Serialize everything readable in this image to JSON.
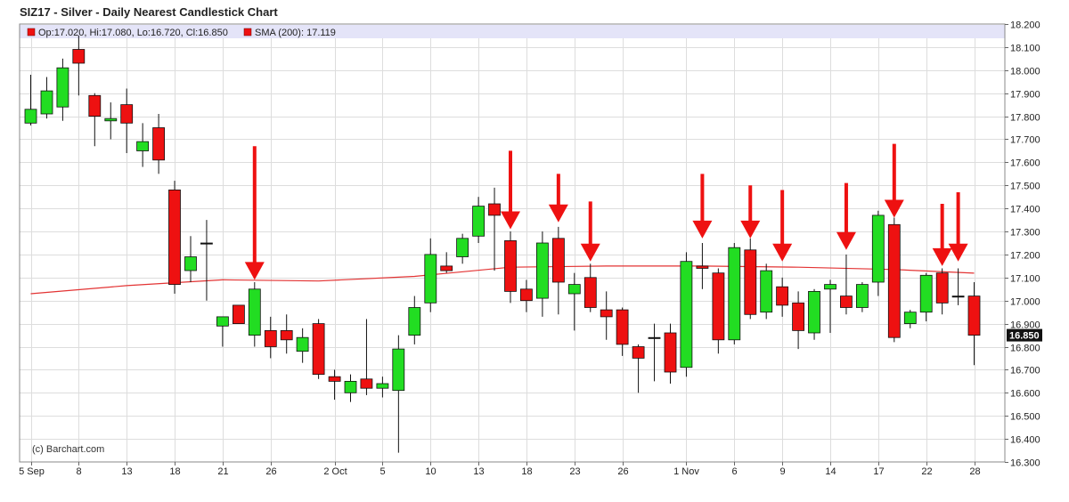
{
  "title": "SIZ17 - Silver - Daily Nearest Candlestick Chart",
  "legend": {
    "ohlc_text": "Op:17.020, Hi:17.080, Lo:16.720, Cl:16.850",
    "sma_text": "SMA (200): 17.119"
  },
  "copyright": "(c) Barchart.com",
  "last_price_label": "16.850",
  "colors": {
    "up": "#22dd22",
    "down": "#ee1111",
    "sma": "#e33333",
    "arrow": "#ee1111",
    "legend_bg": "#e4e4f8",
    "grid": "#dddddd",
    "last_price_bg": "#111111"
  },
  "chart_data": {
    "type": "candlestick",
    "title": "SIZ17 - Silver - Daily Nearest Candlestick Chart",
    "ylim": [
      16.3,
      18.2
    ],
    "y_ticks": [
      16.3,
      16.4,
      16.5,
      16.6,
      16.7,
      16.8,
      16.9,
      17.0,
      17.1,
      17.2,
      17.3,
      17.4,
      17.5,
      17.6,
      17.7,
      17.8,
      17.9,
      18.0,
      18.1,
      18.2
    ],
    "y_tick_labels": [
      "16.300",
      "16.400",
      "16.500",
      "16.600",
      "16.700",
      "16.800",
      "16.900",
      "17.000",
      "17.100",
      "17.200",
      "17.300",
      "17.400",
      "17.500",
      "17.600",
      "17.700",
      "17.800",
      "17.900",
      "18.000",
      "18.100",
      "18.200"
    ],
    "x_tick_labels": [
      {
        "label": "5 Sep",
        "index": 0
      },
      {
        "label": "8",
        "index": 3
      },
      {
        "label": "13",
        "index": 6
      },
      {
        "label": "18",
        "index": 9
      },
      {
        "label": "21",
        "index": 12
      },
      {
        "label": "26",
        "index": 15
      },
      {
        "label": "2 Oct",
        "index": 19
      },
      {
        "label": "5",
        "index": 22
      },
      {
        "label": "10",
        "index": 25
      },
      {
        "label": "13",
        "index": 28
      },
      {
        "label": "18",
        "index": 31
      },
      {
        "label": "23",
        "index": 34
      },
      {
        "label": "26",
        "index": 37
      },
      {
        "label": "1 Nov",
        "index": 41
      },
      {
        "label": "6",
        "index": 44
      },
      {
        "label": "9",
        "index": 47
      },
      {
        "label": "14",
        "index": 50
      },
      {
        "label": "17",
        "index": 53
      },
      {
        "label": "22",
        "index": 56
      },
      {
        "label": "28",
        "index": 59
      }
    ],
    "candles": [
      {
        "o": 17.77,
        "h": 17.98,
        "l": 17.76,
        "c": 17.83
      },
      {
        "o": 17.81,
        "h": 17.97,
        "l": 17.79,
        "c": 17.91
      },
      {
        "o": 17.84,
        "h": 18.05,
        "l": 17.78,
        "c": 18.01
      },
      {
        "o": 18.09,
        "h": 18.15,
        "l": 17.89,
        "c": 18.03
      },
      {
        "o": 17.89,
        "h": 17.9,
        "l": 17.67,
        "c": 17.8
      },
      {
        "o": 17.78,
        "h": 17.86,
        "l": 17.7,
        "c": 17.79
      },
      {
        "o": 17.85,
        "h": 17.92,
        "l": 17.64,
        "c": 17.77
      },
      {
        "o": 17.65,
        "h": 17.77,
        "l": 17.58,
        "c": 17.69
      },
      {
        "o": 17.75,
        "h": 17.81,
        "l": 17.55,
        "c": 17.61
      },
      {
        "o": 17.48,
        "h": 17.52,
        "l": 17.03,
        "c": 17.07
      },
      {
        "o": 17.13,
        "h": 17.28,
        "l": 17.08,
        "c": 17.19
      },
      {
        "o": 17.25,
        "h": 17.35,
        "l": 17.0,
        "c": 17.25
      },
      {
        "o": 16.89,
        "h": 16.93,
        "l": 16.8,
        "c": 16.93
      },
      {
        "o": 16.98,
        "h": 16.98,
        "l": 16.9,
        "c": 16.9
      },
      {
        "o": 16.85,
        "h": 17.08,
        "l": 16.8,
        "c": 17.05
      },
      {
        "o": 16.87,
        "h": 16.93,
        "l": 16.75,
        "c": 16.8
      },
      {
        "o": 16.87,
        "h": 16.94,
        "l": 16.77,
        "c": 16.83
      },
      {
        "o": 16.78,
        "h": 16.88,
        "l": 16.73,
        "c": 16.84
      },
      {
        "o": 16.9,
        "h": 16.92,
        "l": 16.66,
        "c": 16.68
      },
      {
        "o": 16.67,
        "h": 16.7,
        "l": 16.57,
        "c": 16.65
      },
      {
        "o": 16.6,
        "h": 16.68,
        "l": 16.56,
        "c": 16.65
      },
      {
        "o": 16.66,
        "h": 16.92,
        "l": 16.59,
        "c": 16.62
      },
      {
        "o": 16.62,
        "h": 16.67,
        "l": 16.58,
        "c": 16.64
      },
      {
        "o": 16.61,
        "h": 16.85,
        "l": 16.34,
        "c": 16.79
      },
      {
        "o": 16.85,
        "h": 17.02,
        "l": 16.81,
        "c": 16.97
      },
      {
        "o": 16.99,
        "h": 17.27,
        "l": 16.95,
        "c": 17.2
      },
      {
        "o": 17.15,
        "h": 17.21,
        "l": 17.12,
        "c": 17.13
      },
      {
        "o": 17.19,
        "h": 17.29,
        "l": 17.16,
        "c": 17.27
      },
      {
        "o": 17.28,
        "h": 17.45,
        "l": 17.25,
        "c": 17.41
      },
      {
        "o": 17.42,
        "h": 17.49,
        "l": 17.13,
        "c": 17.37
      },
      {
        "o": 17.26,
        "h": 17.3,
        "l": 16.99,
        "c": 17.04
      },
      {
        "o": 17.05,
        "h": 17.09,
        "l": 16.95,
        "c": 17.0
      },
      {
        "o": 17.01,
        "h": 17.3,
        "l": 16.93,
        "c": 17.25
      },
      {
        "o": 17.27,
        "h": 17.32,
        "l": 16.94,
        "c": 17.08
      },
      {
        "o": 17.03,
        "h": 17.12,
        "l": 16.87,
        "c": 17.07
      },
      {
        "o": 17.1,
        "h": 17.16,
        "l": 16.95,
        "c": 16.97
      },
      {
        "o": 16.96,
        "h": 17.04,
        "l": 16.83,
        "c": 16.93
      },
      {
        "o": 16.96,
        "h": 16.97,
        "l": 16.76,
        "c": 16.81
      },
      {
        "o": 16.8,
        "h": 16.81,
        "l": 16.6,
        "c": 16.75
      },
      {
        "o": 16.84,
        "h": 16.9,
        "l": 16.65,
        "c": 16.84
      },
      {
        "o": 16.86,
        "h": 16.9,
        "l": 16.64,
        "c": 16.69
      },
      {
        "o": 16.71,
        "h": 17.21,
        "l": 16.67,
        "c": 17.17
      },
      {
        "o": 17.15,
        "h": 17.25,
        "l": 17.05,
        "c": 17.14
      },
      {
        "o": 17.12,
        "h": 17.14,
        "l": 16.77,
        "c": 16.83
      },
      {
        "o": 16.83,
        "h": 17.25,
        "l": 16.81,
        "c": 17.23
      },
      {
        "o": 17.22,
        "h": 17.27,
        "l": 16.92,
        "c": 16.94
      },
      {
        "o": 16.95,
        "h": 17.16,
        "l": 16.92,
        "c": 17.13
      },
      {
        "o": 17.06,
        "h": 17.1,
        "l": 16.93,
        "c": 16.98
      },
      {
        "o": 16.99,
        "h": 17.04,
        "l": 16.79,
        "c": 16.87
      },
      {
        "o": 16.86,
        "h": 17.05,
        "l": 16.83,
        "c": 17.04
      },
      {
        "o": 17.05,
        "h": 17.09,
        "l": 16.86,
        "c": 17.07
      },
      {
        "o": 17.02,
        "h": 17.2,
        "l": 16.94,
        "c": 16.97
      },
      {
        "o": 16.97,
        "h": 17.08,
        "l": 16.95,
        "c": 17.07
      },
      {
        "o": 17.08,
        "h": 17.39,
        "l": 17.02,
        "c": 17.37
      },
      {
        "o": 17.33,
        "h": 17.36,
        "l": 16.82,
        "c": 16.84
      },
      {
        "o": 16.9,
        "h": 16.96,
        "l": 16.88,
        "c": 16.95
      },
      {
        "o": 16.95,
        "h": 17.12,
        "l": 16.91,
        "c": 17.11
      },
      {
        "o": 17.12,
        "h": 17.14,
        "l": 16.94,
        "c": 16.99
      },
      {
        "o": 17.02,
        "h": 17.14,
        "l": 16.98,
        "c": 17.02
      },
      {
        "o": 17.02,
        "h": 17.08,
        "l": 16.72,
        "c": 16.85
      }
    ],
    "sma": {
      "period": 200,
      "points": [
        {
          "index": 0,
          "value": 17.03
        },
        {
          "index": 6,
          "value": 17.065
        },
        {
          "index": 12,
          "value": 17.09
        },
        {
          "index": 18,
          "value": 17.085
        },
        {
          "index": 24,
          "value": 17.105
        },
        {
          "index": 30,
          "value": 17.145
        },
        {
          "index": 36,
          "value": 17.15
        },
        {
          "index": 42,
          "value": 17.15
        },
        {
          "index": 48,
          "value": 17.145
        },
        {
          "index": 54,
          "value": 17.135
        },
        {
          "index": 59,
          "value": 17.119
        }
      ]
    },
    "arrows": [
      {
        "index": 14,
        "top": 17.67,
        "tip": 17.09
      },
      {
        "index": 30,
        "top": 17.65,
        "tip": 17.31
      },
      {
        "index": 33,
        "top": 17.55,
        "tip": 17.34
      },
      {
        "index": 35,
        "top": 17.43,
        "tip": 17.17
      },
      {
        "index": 42,
        "top": 17.55,
        "tip": 17.27
      },
      {
        "index": 45,
        "top": 17.5,
        "tip": 17.27
      },
      {
        "index": 47,
        "top": 17.48,
        "tip": 17.17
      },
      {
        "index": 51,
        "top": 17.51,
        "tip": 17.22
      },
      {
        "index": 54,
        "top": 17.68,
        "tip": 17.36
      },
      {
        "index": 57,
        "top": 17.42,
        "tip": 17.15
      },
      {
        "index": 58,
        "top": 17.47,
        "tip": 17.17
      }
    ]
  }
}
